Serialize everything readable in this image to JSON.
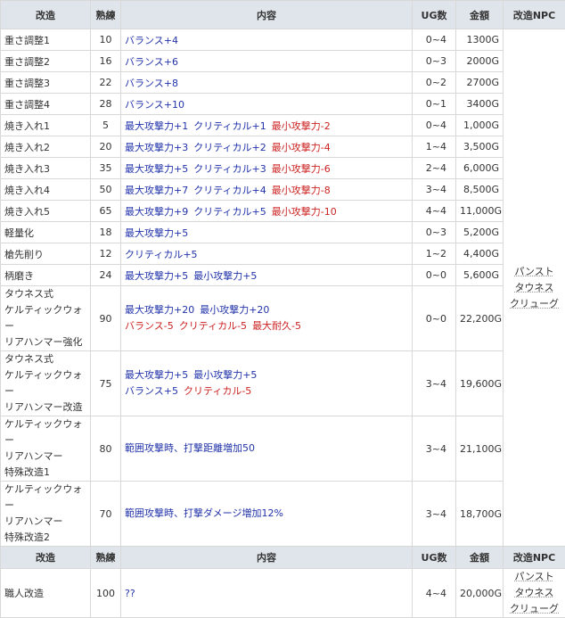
{
  "headers": [
    "改造",
    "熟練",
    "内容",
    "UG数",
    "金額",
    "改造NPC"
  ],
  "npc": [
    "パンスト",
    "タウネス",
    "クリューグ"
  ],
  "rows": [
    {
      "name": "重さ調整1",
      "skill": "10",
      "desc": [
        {
          "t": "バランス+4",
          "c": "blue"
        }
      ],
      "ug": "0~4",
      "gold": "1300G"
    },
    {
      "name": "重さ調整2",
      "skill": "16",
      "desc": [
        {
          "t": "バランス+6",
          "c": "blue"
        }
      ],
      "ug": "0~3",
      "gold": "2000G"
    },
    {
      "name": "重さ調整3",
      "skill": "22",
      "desc": [
        {
          "t": "バランス+8",
          "c": "blue"
        }
      ],
      "ug": "0~2",
      "gold": "2700G"
    },
    {
      "name": "重さ調整4",
      "skill": "28",
      "desc": [
        {
          "t": "バランス+10",
          "c": "blue"
        }
      ],
      "ug": "0~1",
      "gold": "3400G"
    },
    {
      "name": "焼き入れ1",
      "skill": "5",
      "desc": [
        {
          "t": "最大攻撃力+1",
          "c": "blue"
        },
        {
          "t": "クリティカル+1",
          "c": "blue"
        },
        {
          "t": "最小攻撃力-2",
          "c": "red"
        }
      ],
      "ug": "0~4",
      "gold": "1,000G"
    },
    {
      "name": "焼き入れ2",
      "skill": "20",
      "desc": [
        {
          "t": "最大攻撃力+3",
          "c": "blue"
        },
        {
          "t": "クリティカル+2",
          "c": "blue"
        },
        {
          "t": "最小攻撃力-4",
          "c": "red"
        }
      ],
      "ug": "1~4",
      "gold": "3,500G"
    },
    {
      "name": "焼き入れ3",
      "skill": "35",
      "desc": [
        {
          "t": "最大攻撃力+5",
          "c": "blue"
        },
        {
          "t": "クリティカル+3",
          "c": "blue"
        },
        {
          "t": "最小攻撃力-6",
          "c": "red"
        }
      ],
      "ug": "2~4",
      "gold": "6,000G"
    },
    {
      "name": "焼き入れ4",
      "skill": "50",
      "desc": [
        {
          "t": "最大攻撃力+7",
          "c": "blue"
        },
        {
          "t": "クリティカル+4",
          "c": "blue"
        },
        {
          "t": "最小攻撃力-8",
          "c": "red"
        }
      ],
      "ug": "3~4",
      "gold": "8,500G"
    },
    {
      "name": "焼き入れ5",
      "skill": "65",
      "desc": [
        {
          "t": "最大攻撃力+9",
          "c": "blue"
        },
        {
          "t": "クリティカル+5",
          "c": "blue"
        },
        {
          "t": "最小攻撃力-10",
          "c": "red"
        }
      ],
      "ug": "4~4",
      "gold": "11,000G"
    },
    {
      "name": "軽量化",
      "skill": "18",
      "desc": [
        {
          "t": "最大攻撃力+5",
          "c": "blue"
        }
      ],
      "ug": "0~3",
      "gold": "5,200G"
    },
    {
      "name": "槍先削り",
      "skill": "12",
      "desc": [
        {
          "t": "クリティカル+5",
          "c": "blue"
        }
      ],
      "ug": "1~2",
      "gold": "4,400G"
    },
    {
      "name": "柄磨き",
      "skill": "24",
      "desc": [
        {
          "t": "最大攻撃力+5",
          "c": "blue"
        },
        {
          "t": "最小攻撃力+5",
          "c": "blue"
        }
      ],
      "ug": "0~0",
      "gold": "5,600G"
    }
  ],
  "rows_multi": [
    {
      "name": [
        "タウネス式",
        "ケルティックウォー",
        "リアハンマー強化"
      ],
      "skill": "90",
      "desc": [
        [
          {
            "t": "最大攻撃力+20",
            "c": "blue"
          },
          {
            "t": "最小攻撃力+20",
            "c": "blue"
          }
        ],
        [
          {
            "t": "バランス-5",
            "c": "red"
          },
          {
            "t": "クリティカル-5",
            "c": "red"
          },
          {
            "t": "最大耐久-5",
            "c": "red"
          }
        ]
      ],
      "ug": "0~0",
      "gold": "22,200G"
    },
    {
      "name": [
        "タウネス式",
        "ケルティックウォー",
        "リアハンマー改造"
      ],
      "skill": "75",
      "desc": [
        [
          {
            "t": "最大攻撃力+5",
            "c": "blue"
          },
          {
            "t": "最小攻撃力+5",
            "c": "blue"
          }
        ],
        [
          {
            "t": "バランス+5",
            "c": "blue"
          },
          {
            "t": "クリティカル-5",
            "c": "red"
          }
        ]
      ],
      "ug": "3~4",
      "gold": "19,600G"
    },
    {
      "name": [
        "ケルティックウォー",
        "リアハンマー",
        "特殊改造1"
      ],
      "skill": "80",
      "desc": [
        [
          {
            "t": "範囲攻撃時、打撃距離増加50",
            "c": "blue"
          }
        ]
      ],
      "ug": "3~4",
      "gold": "21,100G"
    },
    {
      "name": [
        "ケルティックウォー",
        "リアハンマー",
        "特殊改造2"
      ],
      "skill": "70",
      "desc": [
        [
          {
            "t": "範囲攻撃時、打撃ダメージ増加12%",
            "c": "blue"
          }
        ]
      ],
      "ug": "3~4",
      "gold": "18,700G"
    }
  ],
  "section2": {
    "headers": [
      "改造",
      "熟練",
      "内容",
      "UG数",
      "金額",
      "改造NPC"
    ],
    "row": {
      "name": "職人改造",
      "skill": "100",
      "desc": "??",
      "ug": "4~4",
      "gold": "20,000G"
    },
    "npc": [
      "パンスト",
      "タウネス",
      "クリューグ"
    ]
  }
}
